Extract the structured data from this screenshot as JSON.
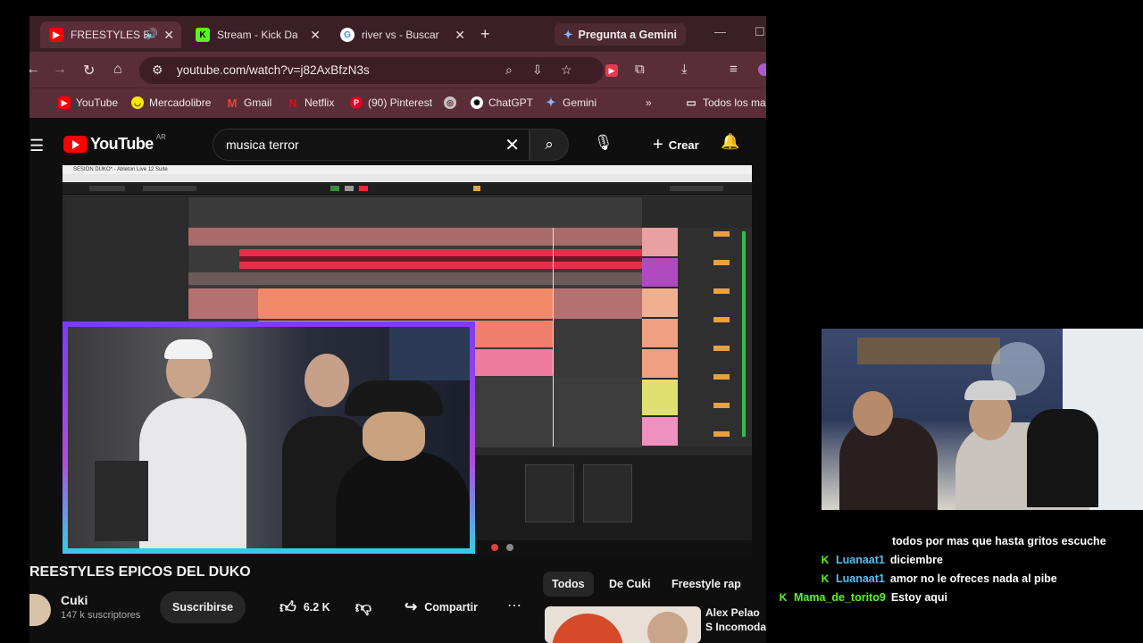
{
  "browser": {
    "tabs": [
      {
        "label": "FREESTYLES E",
        "icon": "youtube-icon",
        "active": true
      },
      {
        "label": "Stream - Kick Das",
        "icon": "kick-icon",
        "active": false
      },
      {
        "label": "river vs - Buscar c",
        "icon": "google-icon",
        "active": false
      }
    ],
    "gemini_label": "Pregunta a Gemini",
    "url": "youtube.com/watch?v=j82AxBfzN3s",
    "bookmarks": [
      {
        "label": "YouTube",
        "icon": "youtube-icon"
      },
      {
        "label": "Mercadolibre",
        "icon": "mercadolibre-icon"
      },
      {
        "label": "Gmail",
        "icon": "gmail-icon"
      },
      {
        "label": "Netflix",
        "icon": "netflix-icon"
      },
      {
        "label": "(90) Pinterest",
        "icon": "pinterest-icon"
      },
      {
        "label": "",
        "icon": "globe-icon"
      },
      {
        "label": "ChatGPT",
        "icon": "chatgpt-icon"
      },
      {
        "label": "Gemini",
        "icon": "gemini-icon"
      },
      {
        "label": "Todos los ma",
        "icon": "folder-icon"
      }
    ]
  },
  "youtube": {
    "logo_word": "YouTube",
    "country": "AR",
    "search_query": "musica terror",
    "create_label": "Crear",
    "video_title": "REESTYLES EPICOS DEL DUKO",
    "channel_name": "Cuki",
    "subscribers": "147 k suscriptores",
    "subscribe_label": "Suscribirse",
    "likes": "6.2 K",
    "share_label": "Compartir",
    "chips": [
      "Todos",
      "De Cuki",
      "Freestyle rap"
    ],
    "related_title": "Alex Pelao S Incomoda ..."
  },
  "daw": {
    "window_title": "SESION DUKO* - Ableton Live 12 Suite"
  },
  "chat": {
    "messages": [
      {
        "user": "",
        "text": "todos por mas que hasta gritos escuche",
        "badge": false
      },
      {
        "user": "Luanaat1",
        "text": "diciembre",
        "badge": true
      },
      {
        "user": "Luanaat1",
        "text": "amor no le ofreces nada al pibe",
        "badge": true
      },
      {
        "user": "Mama_de_torito9",
        "text": "Estoy aqui",
        "badge": true
      }
    ]
  },
  "colors": {
    "tab_bar": "#3b1f26",
    "toolbar": "#5a2e39",
    "youtube_red": "#ff0000",
    "kick_green": "#53fc18",
    "chat_user": "#4fc3f7"
  }
}
